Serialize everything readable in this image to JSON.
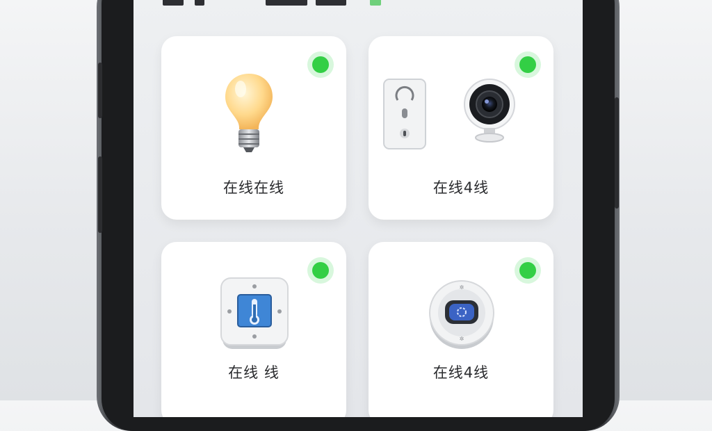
{
  "devices": [
    {
      "label": "在线在线",
      "icon": "light-bulb-icon",
      "status": "online"
    },
    {
      "label": "在线4线",
      "icon": "camera-and-outlet-icon",
      "status": "online"
    },
    {
      "label": "在线 线",
      "icon": "thermostat-icon",
      "status": "online"
    },
    {
      "label": "在线4线",
      "icon": "smart-dial-icon",
      "status": "online"
    }
  ],
  "colors": {
    "online": "#33cf45",
    "card": "#ffffff",
    "screen": "#eceef1"
  }
}
